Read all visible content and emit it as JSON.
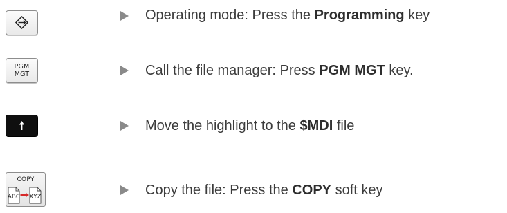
{
  "steps": [
    {
      "key": {
        "type": "programming-key",
        "icon": "programming-icon"
      },
      "pre": "Operating mode: Press the ",
      "bold": "Programming",
      "post": " key"
    },
    {
      "key": {
        "type": "pgm-mgt-key",
        "line1": "PGM",
        "line2": "MGT"
      },
      "pre": "Call the file manager: Press ",
      "bold": "PGM MGT",
      "post": " key."
    },
    {
      "key": {
        "type": "arrow-up-key",
        "icon": "arrow-up-icon"
      },
      "pre": "Move the highlight to the ",
      "bold": "$MDI",
      "post": " file"
    },
    {
      "key": {
        "type": "copy-soft-key",
        "label": "COPY",
        "source": "ABC",
        "target": "XYZ",
        "icon": "copy-file-icon"
      },
      "pre": "Copy the file: Press the ",
      "bold": "COPY",
      "post": " soft key"
    }
  ],
  "colors": {
    "text": "#3c3c3c",
    "bullet": "#8a8a8a",
    "arrow": "#d62828",
    "dark_key": "#0f0f0f"
  }
}
